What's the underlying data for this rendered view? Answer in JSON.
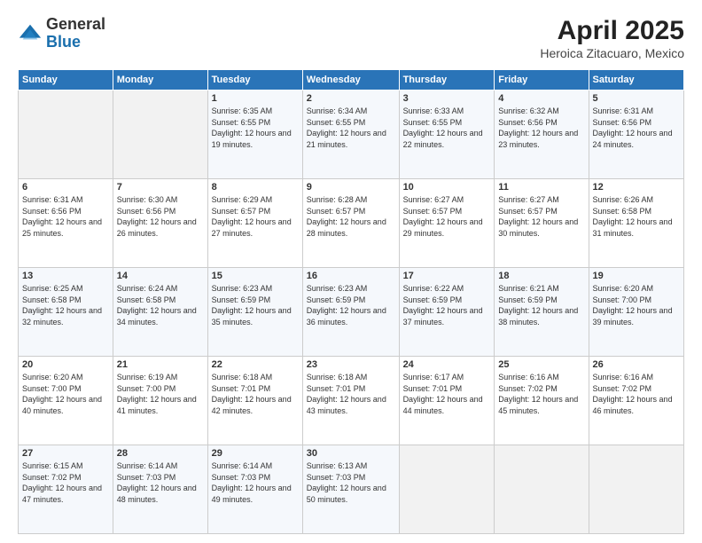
{
  "header": {
    "logo_general": "General",
    "logo_blue": "Blue",
    "title": "April 2025",
    "subtitle": "Heroica Zitacuaro, Mexico"
  },
  "days_of_week": [
    "Sunday",
    "Monday",
    "Tuesday",
    "Wednesday",
    "Thursday",
    "Friday",
    "Saturday"
  ],
  "weeks": [
    [
      {
        "day": "",
        "info": ""
      },
      {
        "day": "",
        "info": ""
      },
      {
        "day": "1",
        "info": "Sunrise: 6:35 AM\nSunset: 6:55 PM\nDaylight: 12 hours and 19 minutes."
      },
      {
        "day": "2",
        "info": "Sunrise: 6:34 AM\nSunset: 6:55 PM\nDaylight: 12 hours and 21 minutes."
      },
      {
        "day": "3",
        "info": "Sunrise: 6:33 AM\nSunset: 6:55 PM\nDaylight: 12 hours and 22 minutes."
      },
      {
        "day": "4",
        "info": "Sunrise: 6:32 AM\nSunset: 6:56 PM\nDaylight: 12 hours and 23 minutes."
      },
      {
        "day": "5",
        "info": "Sunrise: 6:31 AM\nSunset: 6:56 PM\nDaylight: 12 hours and 24 minutes."
      }
    ],
    [
      {
        "day": "6",
        "info": "Sunrise: 6:31 AM\nSunset: 6:56 PM\nDaylight: 12 hours and 25 minutes."
      },
      {
        "day": "7",
        "info": "Sunrise: 6:30 AM\nSunset: 6:56 PM\nDaylight: 12 hours and 26 minutes."
      },
      {
        "day": "8",
        "info": "Sunrise: 6:29 AM\nSunset: 6:57 PM\nDaylight: 12 hours and 27 minutes."
      },
      {
        "day": "9",
        "info": "Sunrise: 6:28 AM\nSunset: 6:57 PM\nDaylight: 12 hours and 28 minutes."
      },
      {
        "day": "10",
        "info": "Sunrise: 6:27 AM\nSunset: 6:57 PM\nDaylight: 12 hours and 29 minutes."
      },
      {
        "day": "11",
        "info": "Sunrise: 6:27 AM\nSunset: 6:57 PM\nDaylight: 12 hours and 30 minutes."
      },
      {
        "day": "12",
        "info": "Sunrise: 6:26 AM\nSunset: 6:58 PM\nDaylight: 12 hours and 31 minutes."
      }
    ],
    [
      {
        "day": "13",
        "info": "Sunrise: 6:25 AM\nSunset: 6:58 PM\nDaylight: 12 hours and 32 minutes."
      },
      {
        "day": "14",
        "info": "Sunrise: 6:24 AM\nSunset: 6:58 PM\nDaylight: 12 hours and 34 minutes."
      },
      {
        "day": "15",
        "info": "Sunrise: 6:23 AM\nSunset: 6:59 PM\nDaylight: 12 hours and 35 minutes."
      },
      {
        "day": "16",
        "info": "Sunrise: 6:23 AM\nSunset: 6:59 PM\nDaylight: 12 hours and 36 minutes."
      },
      {
        "day": "17",
        "info": "Sunrise: 6:22 AM\nSunset: 6:59 PM\nDaylight: 12 hours and 37 minutes."
      },
      {
        "day": "18",
        "info": "Sunrise: 6:21 AM\nSunset: 6:59 PM\nDaylight: 12 hours and 38 minutes."
      },
      {
        "day": "19",
        "info": "Sunrise: 6:20 AM\nSunset: 7:00 PM\nDaylight: 12 hours and 39 minutes."
      }
    ],
    [
      {
        "day": "20",
        "info": "Sunrise: 6:20 AM\nSunset: 7:00 PM\nDaylight: 12 hours and 40 minutes."
      },
      {
        "day": "21",
        "info": "Sunrise: 6:19 AM\nSunset: 7:00 PM\nDaylight: 12 hours and 41 minutes."
      },
      {
        "day": "22",
        "info": "Sunrise: 6:18 AM\nSunset: 7:01 PM\nDaylight: 12 hours and 42 minutes."
      },
      {
        "day": "23",
        "info": "Sunrise: 6:18 AM\nSunset: 7:01 PM\nDaylight: 12 hours and 43 minutes."
      },
      {
        "day": "24",
        "info": "Sunrise: 6:17 AM\nSunset: 7:01 PM\nDaylight: 12 hours and 44 minutes."
      },
      {
        "day": "25",
        "info": "Sunrise: 6:16 AM\nSunset: 7:02 PM\nDaylight: 12 hours and 45 minutes."
      },
      {
        "day": "26",
        "info": "Sunrise: 6:16 AM\nSunset: 7:02 PM\nDaylight: 12 hours and 46 minutes."
      }
    ],
    [
      {
        "day": "27",
        "info": "Sunrise: 6:15 AM\nSunset: 7:02 PM\nDaylight: 12 hours and 47 minutes."
      },
      {
        "day": "28",
        "info": "Sunrise: 6:14 AM\nSunset: 7:03 PM\nDaylight: 12 hours and 48 minutes."
      },
      {
        "day": "29",
        "info": "Sunrise: 6:14 AM\nSunset: 7:03 PM\nDaylight: 12 hours and 49 minutes."
      },
      {
        "day": "30",
        "info": "Sunrise: 6:13 AM\nSunset: 7:03 PM\nDaylight: 12 hours and 50 minutes."
      },
      {
        "day": "",
        "info": ""
      },
      {
        "day": "",
        "info": ""
      },
      {
        "day": "",
        "info": ""
      }
    ]
  ]
}
